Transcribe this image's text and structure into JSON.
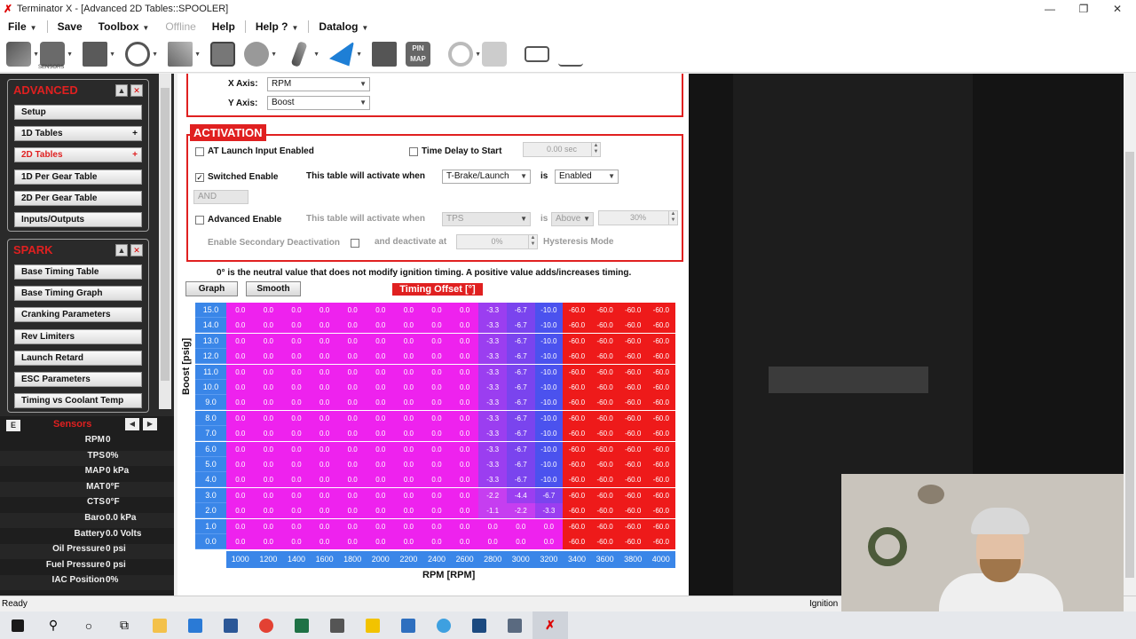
{
  "window": {
    "title": "Terminator X - [Advanced 2D Tables::SPOOLER]",
    "app_glyph": "✗"
  },
  "menu": [
    {
      "label": "File",
      "caret": true
    },
    {
      "label": "Save",
      "caret": false
    },
    {
      "label": "Toolbox",
      "caret": true
    },
    {
      "label": "Offline",
      "caret": false,
      "disabled": true
    },
    {
      "label": "Help",
      "caret": false
    },
    {
      "label": "Help ?",
      "caret": true
    },
    {
      "label": "Datalog",
      "caret": true
    }
  ],
  "toolbar": {
    "sensors_caption": "SENSORS",
    "pin_map_label": "PIN MAP"
  },
  "advanced": {
    "title": "ADVANCED",
    "items": [
      "Setup",
      "1D Tables",
      "2D Tables",
      "1D Per Gear Table",
      "2D Per Gear Table",
      "Inputs/Outputs"
    ],
    "active": "2D Tables"
  },
  "spark": {
    "title": "SPARK",
    "items": [
      "Base Timing Table",
      "Base Timing Graph",
      "Cranking Parameters",
      "Rev Limiters",
      "Launch Retard",
      "ESC Parameters",
      "Timing vs Coolant Temp"
    ]
  },
  "sensors": {
    "title": "Sensors",
    "rows": [
      {
        "label": "RPM",
        "value": "0"
      },
      {
        "label": "TPS",
        "value": "0%"
      },
      {
        "label": "MAP",
        "value": "0 kPa"
      },
      {
        "label": "MAT",
        "value": "0°F"
      },
      {
        "label": "CTS",
        "value": "0°F"
      },
      {
        "label": "Baro",
        "value": "0.0 kPa"
      },
      {
        "label": "Battery",
        "value": "0.0 Volts"
      },
      {
        "label": "Oil Pressure",
        "value": "0 psi"
      },
      {
        "label": "Fuel Pressure",
        "value": "0 psi"
      },
      {
        "label": "IAC Position",
        "value": "0%"
      }
    ]
  },
  "axes": {
    "x_label": "X Axis:",
    "x_value": "RPM",
    "y_label": "Y Axis:",
    "y_value": "Boost"
  },
  "activation": {
    "title": "ACTIVATION",
    "at_launch": "AT Launch Input Enabled",
    "time_delay": "Time Delay to Start",
    "time_delay_value": "0.00 sec",
    "switched_enable": "Switched Enable",
    "activate_when": "This table will activate when",
    "switched_source": "T-Brake/Launch",
    "is": "is",
    "switched_state": "Enabled",
    "and_value": "AND",
    "advanced_enable": "Advanced Enable",
    "advanced_source": "TPS",
    "advanced_state": "Above",
    "advanced_value": "30%",
    "secondary_deactivation": "Enable Secondary Deactivation",
    "deactivate_at": "and deactivate at",
    "deactivate_value": "0%",
    "hysteresis": "Hysteresis Mode"
  },
  "note": "0° is the neutral value that does not modify ignition timing.  A positive value adds/increases timing.",
  "buttons": {
    "graph": "Graph",
    "smooth": "Smooth"
  },
  "table": {
    "title": "Timing Offset [°]",
    "y_axis_label": "Boost [psig]",
    "x_axis_label": "RPM [RPM]",
    "y_values": [
      "15.0",
      "14.0",
      "13.0",
      "12.0",
      "11.0",
      "10.0",
      "9.0",
      "8.0",
      "7.0",
      "6.0",
      "5.0",
      "4.0",
      "3.0",
      "2.0",
      "1.0",
      "0.0"
    ],
    "x_values": [
      "1000",
      "1200",
      "1400",
      "1600",
      "1800",
      "2000",
      "2200",
      "2400",
      "2600",
      "2800",
      "3000",
      "3200",
      "3400",
      "3600",
      "3800",
      "4000"
    ],
    "rows": [
      [
        "0.0",
        "0.0",
        "0.0",
        "0.0",
        "0.0",
        "0.0",
        "0.0",
        "0.0",
        "0.0",
        "-3.3",
        "-6.7",
        "-10.0",
        "-60.0",
        "-60.0",
        "-60.0",
        "-60.0"
      ],
      [
        "0.0",
        "0.0",
        "0.0",
        "0.0",
        "0.0",
        "0.0",
        "0.0",
        "0.0",
        "0.0",
        "-3.3",
        "-6.7",
        "-10.0",
        "-60.0",
        "-60.0",
        "-60.0",
        "-60.0"
      ],
      [
        "0.0",
        "0.0",
        "0.0",
        "0.0",
        "0.0",
        "0.0",
        "0.0",
        "0.0",
        "0.0",
        "-3.3",
        "-6.7",
        "-10.0",
        "-60.0",
        "-60.0",
        "-60.0",
        "-60.0"
      ],
      [
        "0.0",
        "0.0",
        "0.0",
        "0.0",
        "0.0",
        "0.0",
        "0.0",
        "0.0",
        "0.0",
        "-3.3",
        "-6.7",
        "-10.0",
        "-60.0",
        "-60.0",
        "-60.0",
        "-60.0"
      ],
      [
        "0.0",
        "0.0",
        "0.0",
        "0.0",
        "0.0",
        "0.0",
        "0.0",
        "0.0",
        "0.0",
        "-3.3",
        "-6.7",
        "-10.0",
        "-60.0",
        "-60.0",
        "-60.0",
        "-60.0"
      ],
      [
        "0.0",
        "0.0",
        "0.0",
        "0.0",
        "0.0",
        "0.0",
        "0.0",
        "0.0",
        "0.0",
        "-3.3",
        "-6.7",
        "-10.0",
        "-60.0",
        "-60.0",
        "-60.0",
        "-60.0"
      ],
      [
        "0.0",
        "0.0",
        "0.0",
        "0.0",
        "0.0",
        "0.0",
        "0.0",
        "0.0",
        "0.0",
        "-3.3",
        "-6.7",
        "-10.0",
        "-60.0",
        "-60.0",
        "-60.0",
        "-60.0"
      ],
      [
        "0.0",
        "0.0",
        "0.0",
        "0.0",
        "0.0",
        "0.0",
        "0.0",
        "0.0",
        "0.0",
        "-3.3",
        "-6.7",
        "-10.0",
        "-60.0",
        "-60.0",
        "-60.0",
        "-60.0"
      ],
      [
        "0.0",
        "0.0",
        "0.0",
        "0.0",
        "0.0",
        "0.0",
        "0.0",
        "0.0",
        "0.0",
        "-3.3",
        "-6.7",
        "-10.0",
        "-60.0",
        "-60.0",
        "-60.0",
        "-60.0"
      ],
      [
        "0.0",
        "0.0",
        "0.0",
        "0.0",
        "0.0",
        "0.0",
        "0.0",
        "0.0",
        "0.0",
        "-3.3",
        "-6.7",
        "-10.0",
        "-60.0",
        "-60.0",
        "-60.0",
        "-60.0"
      ],
      [
        "0.0",
        "0.0",
        "0.0",
        "0.0",
        "0.0",
        "0.0",
        "0.0",
        "0.0",
        "0.0",
        "-3.3",
        "-6.7",
        "-10.0",
        "-60.0",
        "-60.0",
        "-60.0",
        "-60.0"
      ],
      [
        "0.0",
        "0.0",
        "0.0",
        "0.0",
        "0.0",
        "0.0",
        "0.0",
        "0.0",
        "0.0",
        "-3.3",
        "-6.7",
        "-10.0",
        "-60.0",
        "-60.0",
        "-60.0",
        "-60.0"
      ],
      [
        "0.0",
        "0.0",
        "0.0",
        "0.0",
        "0.0",
        "0.0",
        "0.0",
        "0.0",
        "0.0",
        "-2.2",
        "-4.4",
        "-6.7",
        "-60.0",
        "-60.0",
        "-60.0",
        "-60.0"
      ],
      [
        "0.0",
        "0.0",
        "0.0",
        "0.0",
        "0.0",
        "0.0",
        "0.0",
        "0.0",
        "0.0",
        "-1.1",
        "-2.2",
        "-3.3",
        "-60.0",
        "-60.0",
        "-60.0",
        "-60.0"
      ],
      [
        "0.0",
        "0.0",
        "0.0",
        "0.0",
        "0.0",
        "0.0",
        "0.0",
        "0.0",
        "0.0",
        "0.0",
        "0.0",
        "0.0",
        "-60.0",
        "-60.0",
        "-60.0",
        "-60.0"
      ],
      [
        "0.0",
        "0.0",
        "0.0",
        "0.0",
        "0.0",
        "0.0",
        "0.0",
        "0.0",
        "0.0",
        "0.0",
        "0.0",
        "0.0",
        "-60.0",
        "-60.0",
        "-60.0",
        "-60.0"
      ]
    ]
  },
  "status": {
    "left": "Ready",
    "right": "Ignition"
  },
  "colors": {
    "accent_red": "#e02020",
    "axis_blue": "#3a86e8",
    "cell_zero": "#ee22ee",
    "cell_red": "#ee1a1a"
  }
}
